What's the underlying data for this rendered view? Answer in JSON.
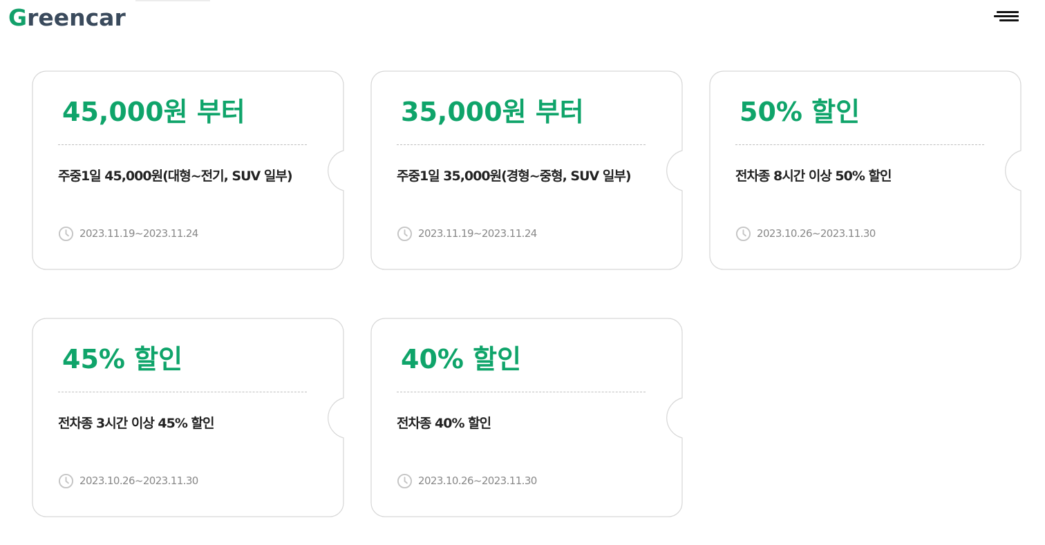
{
  "header": {
    "logo_prefix": "G",
    "logo_rest": "reencar",
    "menu_icon": "hamburger-menu-icon"
  },
  "colors": {
    "accent_green": "#0fa46a",
    "logo_dark": "#3a4a5c",
    "text_dark": "#222222",
    "text_muted": "#888888",
    "card_border": "#d6d6d6"
  },
  "coupons": [
    {
      "title": "45,000원 부터",
      "desc": "주중1일 45,000원(대형~전기, SUV 일부)",
      "period": "2023.11.19~2023.11.24"
    },
    {
      "title": "35,000원 부터",
      "desc": "주중1일 35,000원(경형~중형, SUV 일부)",
      "period": "2023.11.19~2023.11.24"
    },
    {
      "title": "50% 할인",
      "desc": "전차종 8시간 이상 50% 할인",
      "period": "2023.10.26~2023.11.30"
    },
    {
      "title": "45% 할인",
      "desc": "전차종 3시간 이상 45% 할인",
      "period": "2023.10.26~2023.11.30"
    },
    {
      "title": "40% 할인",
      "desc": "전차종 40% 할인",
      "period": "2023.10.26~2023.11.30"
    }
  ]
}
